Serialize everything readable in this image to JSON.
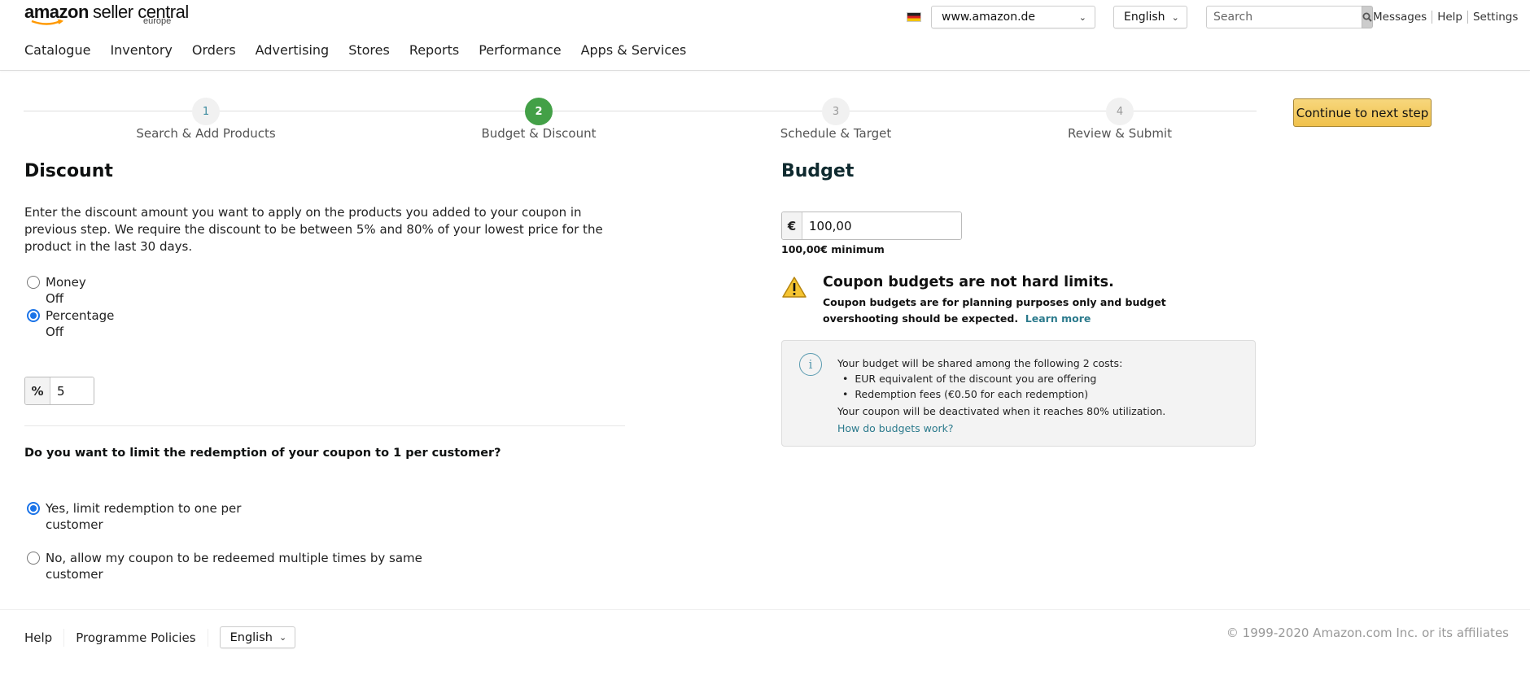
{
  "header": {
    "logo_brand": "amazon",
    "logo_product": "seller central",
    "logo_region": "europe",
    "flag_icon": "germany-flag-icon",
    "marketplace": "www.amazon.de",
    "language": "English",
    "search_placeholder": "Search",
    "links": [
      "Messages",
      "Help",
      "Settings"
    ]
  },
  "nav": [
    "Catalogue",
    "Inventory",
    "Orders",
    "Advertising",
    "Stores",
    "Reports",
    "Performance",
    "Apps & Services"
  ],
  "stepper": {
    "steps": [
      {
        "number": "1",
        "label": "Search & Add Products",
        "state": "completed"
      },
      {
        "number": "2",
        "label": "Budget & Discount",
        "state": "active"
      },
      {
        "number": "3",
        "label": "Schedule & Target",
        "state": "upcoming"
      },
      {
        "number": "4",
        "label": "Review & Submit",
        "state": "upcoming"
      }
    ],
    "active_color": "#43a047"
  },
  "continue_button": "Continue to next step",
  "discount": {
    "title": "Discount",
    "description": "Enter the discount amount you want to apply on the products you added to your coupon in previous step. We require the discount to be between 5% and 80% of your lowest price for the product in the last 30 days.",
    "type_options": [
      {
        "label": "Money\nOff",
        "checked": false
      },
      {
        "label": "Percentage\nOff",
        "checked": true
      }
    ],
    "percent_symbol": "%",
    "percent_value": "5",
    "limit_question": "Do you want to limit the redemption of your coupon to 1 per customer?",
    "limit_options": [
      {
        "label": "Yes, limit redemption to one per\ncustomer",
        "checked": true
      },
      {
        "label": "No, allow my coupon to be redeemed multiple times by same\ncustomer",
        "checked": false
      }
    ]
  },
  "budget": {
    "title": "Budget",
    "currency_symbol": "€",
    "value": "100,00",
    "minimum_note": "100,00€ minimum",
    "alert_title": "Coupon budgets are not hard limits.",
    "alert_text": "Coupon budgets are for planning purposes only and budget overshooting should be expected.",
    "alert_link": "Learn more",
    "info_intro": "Your budget will be shared among the following 2 costs:",
    "info_items": [
      "EUR equivalent of the discount you are offering",
      "Redemption fees (€0.50 for each redemption)"
    ],
    "info_outro": "Your coupon will be deactivated when it reaches 80% utilization.",
    "info_link": "How do budgets work?"
  },
  "footer": {
    "links": [
      "Help",
      "Programme Policies"
    ],
    "language": "English",
    "copyright": "© 1999-2020 Amazon.com Inc. or its affiliates"
  }
}
